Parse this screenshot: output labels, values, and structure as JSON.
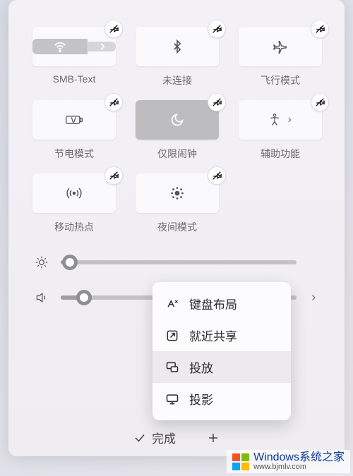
{
  "tiles": [
    {
      "id": "wifi",
      "label": "SMB-Text",
      "icon": "wifi",
      "style": "split",
      "hasChevron": true
    },
    {
      "id": "bluetooth",
      "label": "未连接",
      "icon": "bluetooth",
      "style": "normal"
    },
    {
      "id": "airplane",
      "label": "飞行模式",
      "icon": "airplane",
      "style": "normal"
    },
    {
      "id": "battery",
      "label": "节电模式",
      "icon": "battery-saver",
      "style": "normal"
    },
    {
      "id": "alarm",
      "label": "仅限闹钟",
      "icon": "moon",
      "style": "active"
    },
    {
      "id": "accessibility",
      "label": "辅助功能",
      "icon": "accessibility",
      "style": "normal",
      "hasChevron": true
    },
    {
      "id": "hotspot",
      "label": "移动热点",
      "icon": "hotspot",
      "style": "normal"
    },
    {
      "id": "night",
      "label": "夜间模式",
      "icon": "night-light",
      "style": "normal"
    },
    {
      "id": "empty",
      "label": "",
      "icon": "",
      "style": "empty"
    }
  ],
  "sliders": {
    "brightness": {
      "icon": "brightness",
      "value": 4
    },
    "volume": {
      "icon": "volume",
      "value": 10,
      "hasChevron": true
    }
  },
  "popup": {
    "items": [
      {
        "icon": "keyboard-layout",
        "label": "键盘布局"
      },
      {
        "icon": "nearby-share",
        "label": "就近共享"
      },
      {
        "icon": "cast",
        "label": "投放",
        "hover": true
      },
      {
        "icon": "project",
        "label": "投影"
      }
    ]
  },
  "bottom": {
    "done_label": "完成",
    "add_label": ""
  },
  "watermark": {
    "text": "Windows系统之家",
    "url": "www.bjmlv.com"
  }
}
